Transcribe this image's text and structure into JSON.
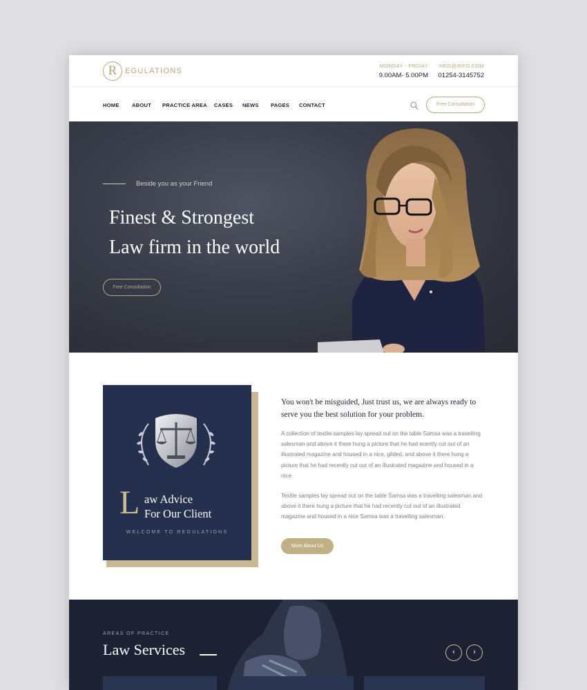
{
  "brand": {
    "logo_letter": "R",
    "name": "EGULATIONS"
  },
  "topbar": {
    "hours_label": "MONDAY - FRIDAY",
    "hours_value": "9.00AM- 5.00PM",
    "email": "REG@INFO.COM",
    "phone": "01254-3145752"
  },
  "nav": {
    "items": [
      "HOME",
      "ABOUT",
      "PRACTICE AREA",
      "CASES",
      "NEWS",
      "PAGES",
      "CONTACT"
    ],
    "cta": "Free Consultation"
  },
  "hero": {
    "tagline": "Beside you as your Friend",
    "title_line1": "Finest & Strongest",
    "title_line2": "Law firm in the world",
    "cta": "Free Consultation"
  },
  "about": {
    "card": {
      "big_letter": "L",
      "line1": "aw Advice",
      "line2": "For Our Client",
      "welcome": "WELCOME TO REGULATIONS"
    },
    "heading": "You won't be misguided, Just trust us, we are always ready to serve you the best solution for your problem.",
    "paragraph1": "A collection of textile samples lay spread out on the table Samsa was a travelling salesman and above it there hung a picture that he had ecently cut out of an illustrated magazine and housed in a nice, gilded, and above it there hung a picture that he had recently cut out of an illustrated magazine and housed in a nice.",
    "paragraph2": "Textile samples lay spread out on the table Samsa was a travelling salesman and above it there hung a picture that he had recently cut out of an illustrated magazine and housed in a nice Samsa was a travelling salesman.",
    "button": "More About Us"
  },
  "services": {
    "eyebrow": "AREAS OF PRACTICE",
    "title": "Law Services",
    "prev_glyph": "‹",
    "next_glyph": "›"
  },
  "colors": {
    "gold": "#b8a57a",
    "navy": "#25304f",
    "dark_section": "#1c2233"
  }
}
